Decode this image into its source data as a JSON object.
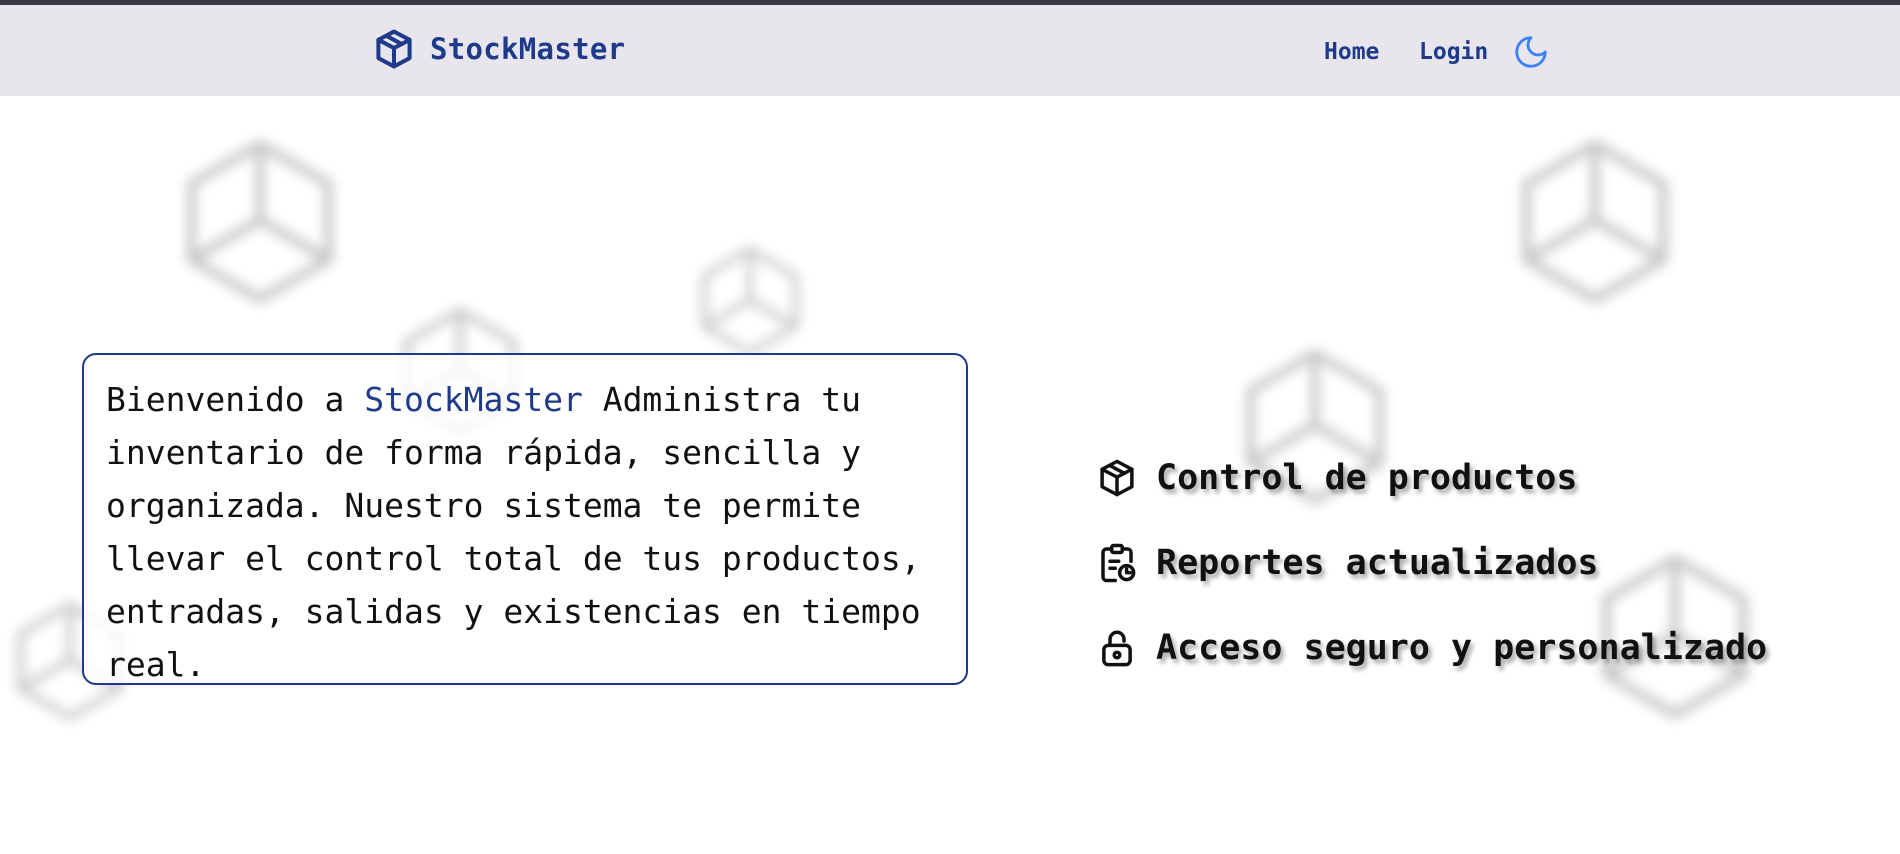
{
  "navbar": {
    "brand": "StockMaster",
    "brand_icon": "box-icon",
    "links": [
      {
        "label": "Home"
      },
      {
        "label": "Login"
      }
    ],
    "theme_icon": "moon-icon"
  },
  "welcome": {
    "prefix": "Bienvenido a ",
    "brand": "StockMaster",
    "body": " Administra tu inventario de forma rápida, sencilla y organizada. Nuestro sistema te permite llevar el control total de tus productos, entradas, salidas y existencias en tiempo real."
  },
  "features": [
    {
      "label": "Control de productos",
      "icon": "box-icon"
    },
    {
      "label": "Reportes actualizados",
      "icon": "clipboard-report-icon"
    },
    {
      "label": "Acceso seguro y personalizado",
      "icon": "lock-icon"
    }
  ],
  "colors": {
    "brand": "#1e3a8a",
    "navbar_bg": "#e8e6ec",
    "theme_icon": "#3b82f6",
    "text": "#111111"
  }
}
